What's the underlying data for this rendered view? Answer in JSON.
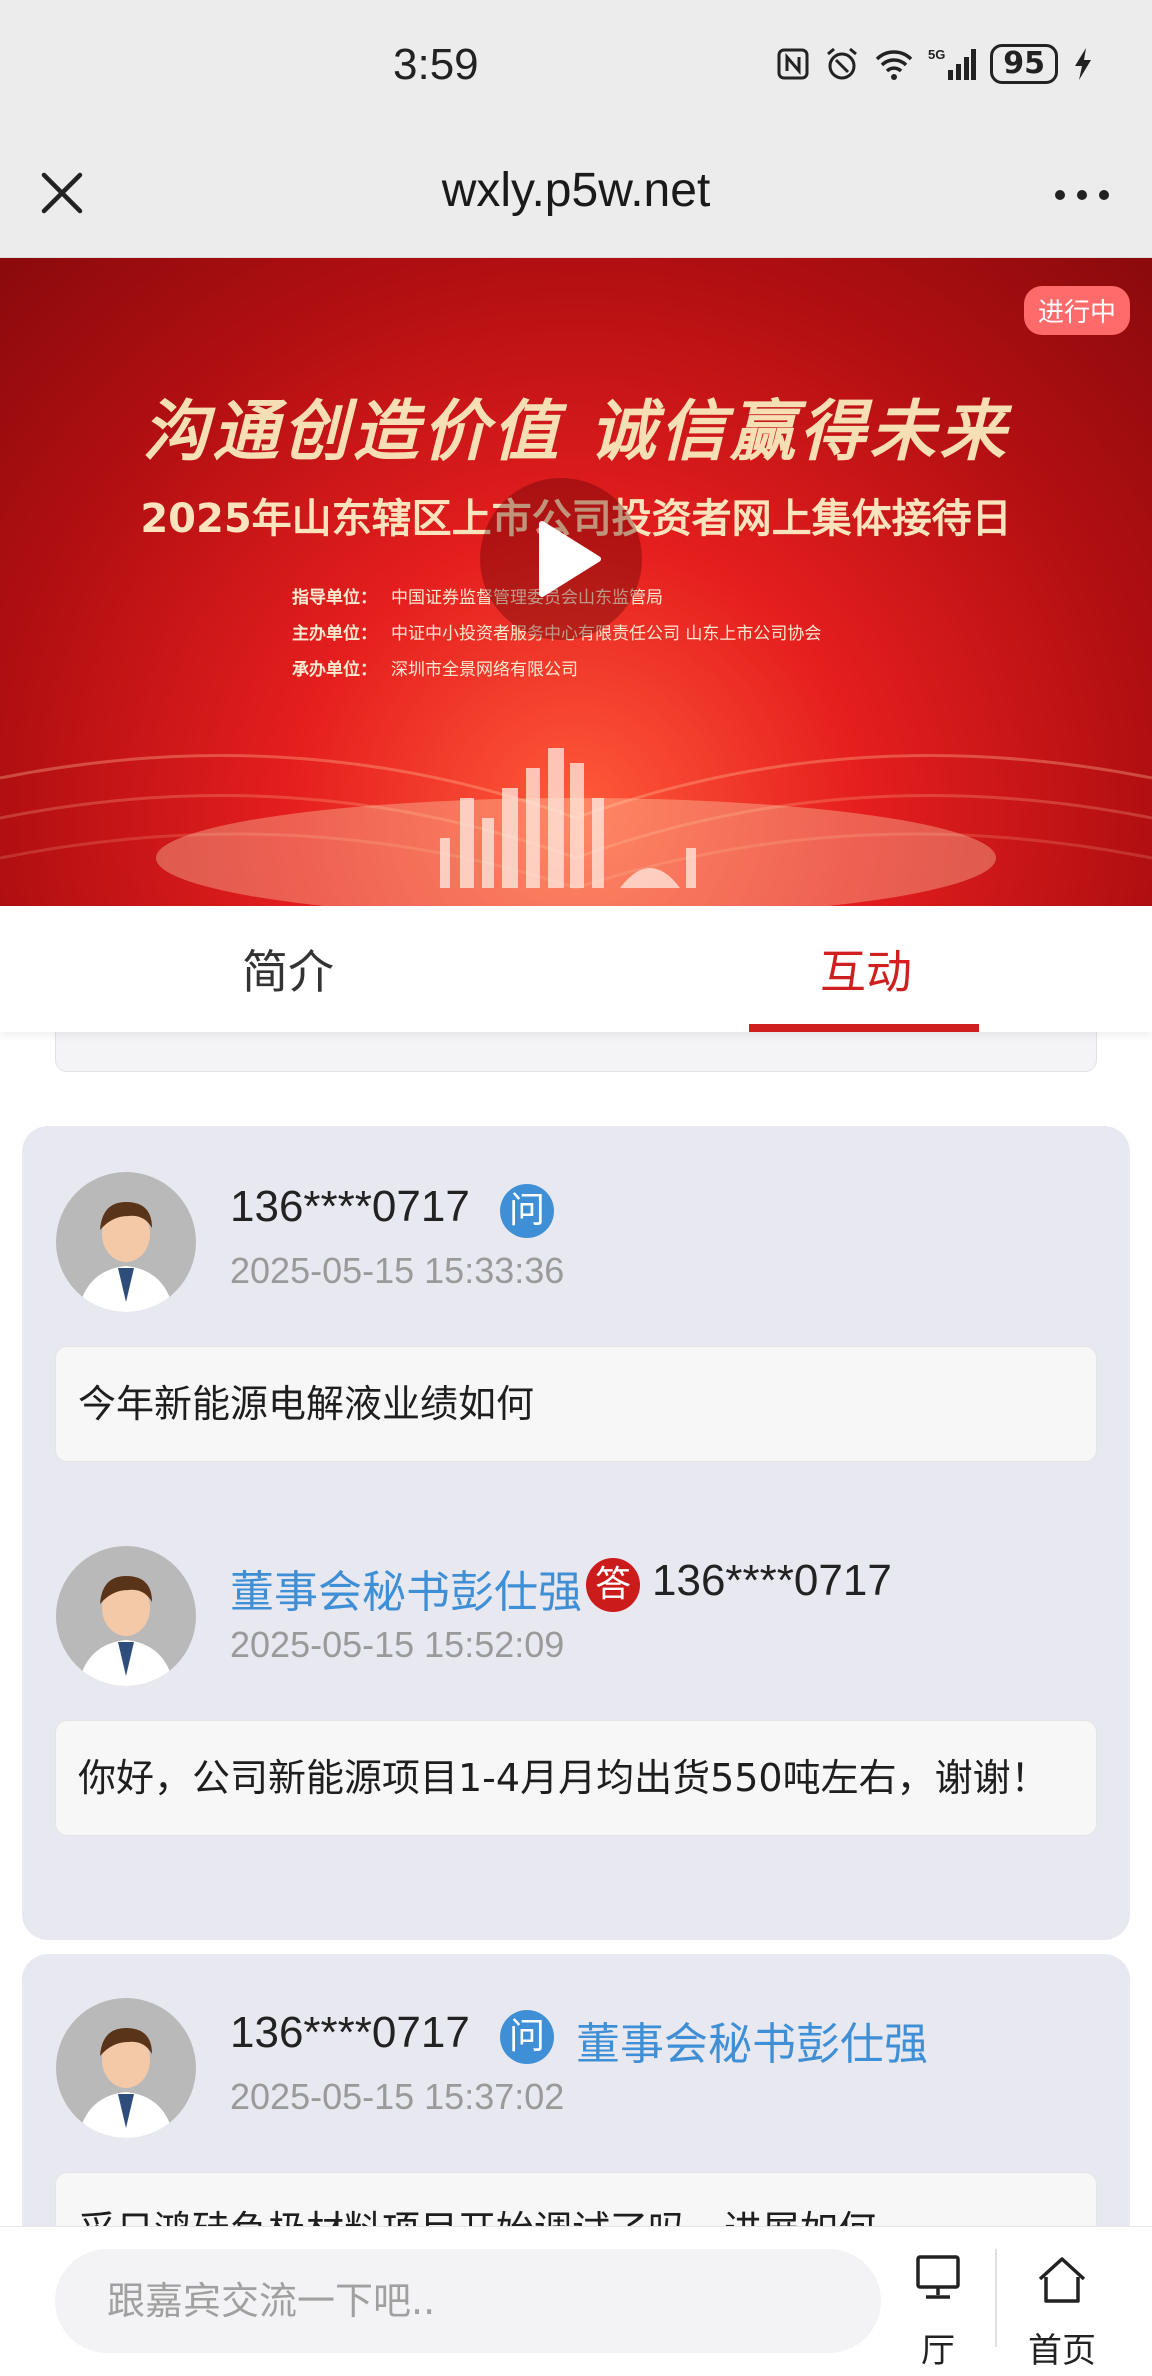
{
  "status_bar": {
    "time": "3:59",
    "icons": [
      "nfc-icon",
      "alarm-icon",
      "wifi-icon",
      "5g-signal-icon",
      "charging-icon"
    ],
    "battery": "95"
  },
  "nav": {
    "title": "wxly.p5w.net"
  },
  "banner": {
    "slogan": "沟通创造价值  诚信赢得未来",
    "title": "2025年山东辖区上市公司投资者网上集体接待日",
    "guide_label": "指导单位：",
    "guide_value": "中国证券监督管理委员会山东监管局",
    "host_label": "主办单位：",
    "host_value": "中证中小投资者服务中心有限责任公司  山东上市公司协会",
    "organizer_label": "承办单位：",
    "organizer_value": "深圳市全景网络有限公司",
    "live_badge": "进行中"
  },
  "tabs": [
    {
      "label": "简介"
    },
    {
      "label": "互动",
      "active": true
    }
  ],
  "posts": [
    {
      "question": {
        "user": "136****0717",
        "badge": "问",
        "time": "2025-05-15 15:33:36",
        "text": "今年新能源电解液业绩如何"
      },
      "answer": {
        "user": "董事会秘书彭仕强",
        "badge": "答",
        "to_user": "136****0717",
        "time": "2025-05-15 15:52:09",
        "text": "你好，公司新能源项目1-4月月均出货550吨左右，谢谢！"
      }
    },
    {
      "question": {
        "user": "136****0717",
        "badge": "问",
        "to_user": "董事会秘书彭仕强",
        "time": "2025-05-15 15:37:02",
        "text": "采日鸿硅负极材料项目开始调试了吗，进展如何"
      }
    }
  ],
  "bottom_bar": {
    "input_placeholder": "跟嘉宾交流一下吧..",
    "hall_label": "厅",
    "home_label": "首页"
  },
  "colors": {
    "accent_red": "#d01f1f",
    "link_blue": "#3f8fd6",
    "card_bg": "#e8e8f0"
  }
}
